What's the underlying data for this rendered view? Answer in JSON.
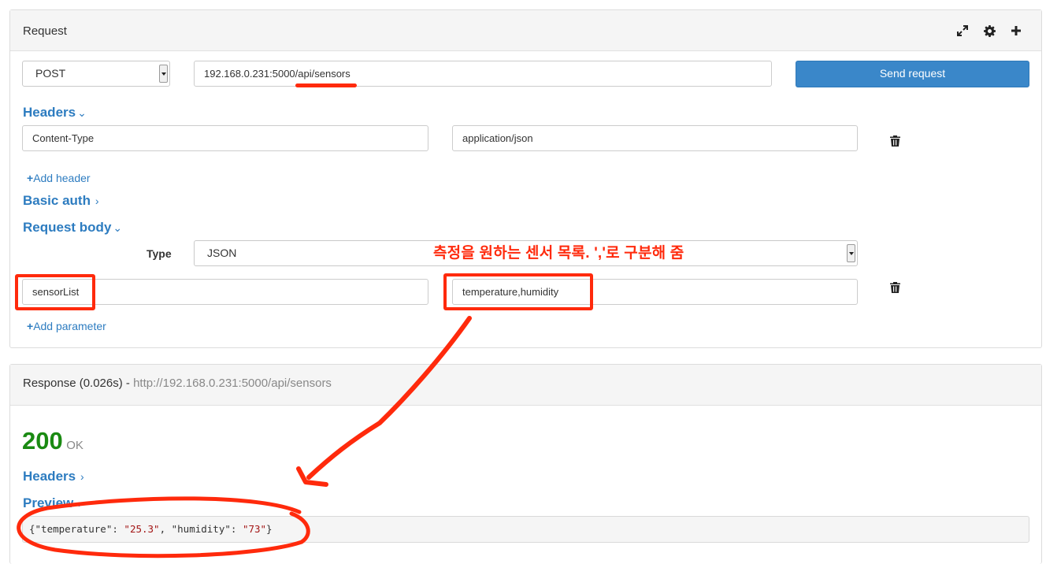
{
  "request": {
    "title": "Request",
    "method": "POST",
    "url": "192.168.0.231:5000/api/sensors",
    "send_label": "Send request",
    "headers_label": "Headers",
    "headers": [
      {
        "key": "Content-Type",
        "value": "application/json"
      }
    ],
    "add_header_label": "Add header",
    "basic_auth_label": "Basic auth",
    "request_body_label": "Request body",
    "type_label": "Type",
    "body_type": "JSON",
    "params": [
      {
        "key": "sensorList",
        "value": "temperature,humidity"
      }
    ],
    "add_param_label": "Add parameter"
  },
  "annotation": {
    "text": "측정을 원하는 센서 목록. ','로 구분해 줌",
    "color": "#ff2a0c"
  },
  "response": {
    "title_prefix": "Response (0.026s) - ",
    "title_url": "http://192.168.0.231:5000/api/sensors",
    "status_code": "200",
    "status_text": "OK",
    "headers_label": "Headers",
    "preview_label": "Preview",
    "preview_parts": {
      "open": "{\"temperature\": ",
      "temp": "\"25.3\"",
      "mid": ", \"humidity\": ",
      "hum": "\"73\"",
      "close": "}"
    }
  },
  "colors": {
    "accent": "#3a87c9",
    "link": "#2d7cc0",
    "status_ok": "#1a8a12"
  },
  "icons": [
    "expand-icon",
    "gear-icon",
    "plus-icon",
    "trash-icon",
    "chevron-down-icon",
    "chevron-right-icon"
  ]
}
